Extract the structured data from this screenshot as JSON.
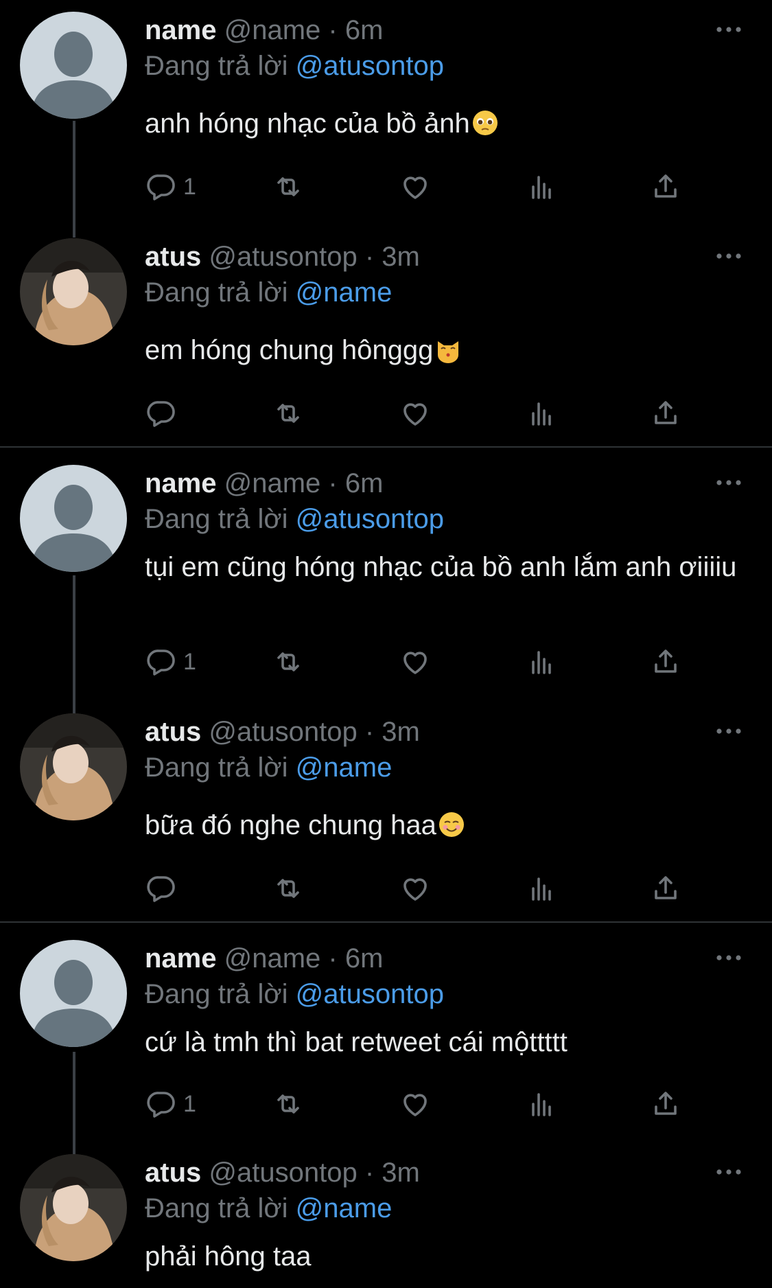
{
  "tweets": [
    {
      "name": "name",
      "handle": "@name",
      "time": "6m",
      "reply_prefix": "Đang trả lời",
      "reply_to": "@atusontop",
      "text": "anh hóng nhạc của bồ ảnh",
      "emoji": "pleading-face",
      "reply_count": "1",
      "avatar": "default-avatar"
    },
    {
      "name": "atus",
      "handle": "@atusontop",
      "time": "3m",
      "reply_prefix": "Đang trả lời",
      "reply_to": "@name",
      "text": "em hóng chung hônggg",
      "emoji": "kissing-cat-face",
      "reply_count": "",
      "avatar": "photo-avatar"
    },
    {
      "name": "name",
      "handle": "@name",
      "time": "6m",
      "reply_prefix": "Đang trả lời",
      "reply_to": "@atusontop",
      "text": "tụi em cũng hóng nhạc của bồ anh lắm anh ơiiiiu",
      "emoji": "",
      "reply_count": "1",
      "avatar": "default-avatar"
    },
    {
      "name": "atus",
      "handle": "@atusontop",
      "time": "3m",
      "reply_prefix": "Đang trả lời",
      "reply_to": "@name",
      "text": "bữa đó nghe chung haa",
      "emoji": "smiling-face",
      "reply_count": "",
      "avatar": "photo-avatar"
    },
    {
      "name": "name",
      "handle": "@name",
      "time": "6m",
      "reply_prefix": "Đang trả lời",
      "reply_to": "@atusontop",
      "text": "cứ là tmh thì bat retweet cái mộttttt",
      "emoji": "",
      "reply_count": "1",
      "avatar": "default-avatar"
    },
    {
      "name": "atus",
      "handle": "@atusontop",
      "time": "3m",
      "reply_prefix": "Đang trả lời",
      "reply_to": "@name",
      "text": "phải hông taa",
      "emoji": "",
      "reply_count": "",
      "avatar": "photo-avatar"
    }
  ],
  "colors": {
    "background": "#000000",
    "name": "#e7e9ea",
    "meta": "#71767b",
    "mention": "#4b9ce8",
    "divider": "#2f3336"
  },
  "icons": [
    "more-icon",
    "reply-icon",
    "retweet-icon",
    "like-icon",
    "analytics-icon",
    "share-icon"
  ]
}
